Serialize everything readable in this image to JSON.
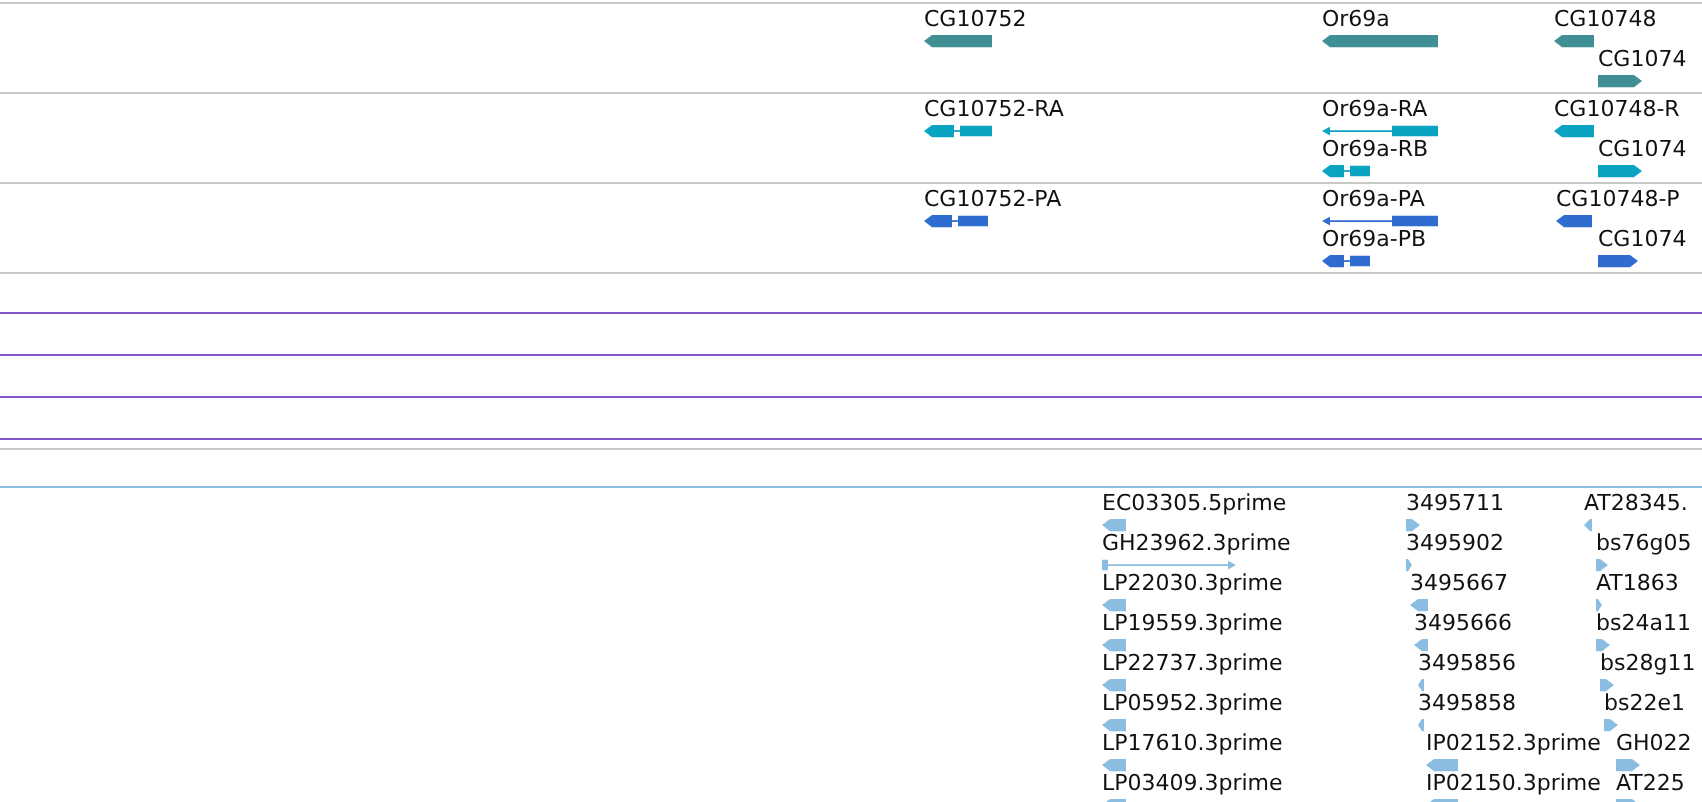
{
  "tracks": [
    {
      "kind": "features",
      "color": "#3f8f94",
      "features": [
        {
          "label": "CG10752",
          "reverse": true,
          "kind": "block"
        },
        {
          "label": "Or69a",
          "reverse": true,
          "kind": "block"
        },
        {
          "label": "CG10748",
          "reverse": true,
          "kind": "block"
        },
        {
          "label": "CG1074",
          "reverse": false,
          "kind": "block"
        }
      ]
    },
    {
      "kind": "features",
      "color": "#0aa3c2",
      "features": [
        {
          "label": "CG10752-RA",
          "reverse": true,
          "kind": "exons"
        },
        {
          "label": "Or69a-RA",
          "reverse": true,
          "kind": "spliced"
        },
        {
          "label": "Or69a-RB",
          "reverse": true,
          "kind": "exons"
        },
        {
          "label": "CG10748-R",
          "reverse": true,
          "kind": "block"
        },
        {
          "label": "CG1074",
          "reverse": false,
          "kind": "block"
        }
      ]
    },
    {
      "kind": "features",
      "color": "#2f6cd0",
      "features": [
        {
          "label": "CG10752-PA",
          "reverse": true,
          "kind": "exons"
        },
        {
          "label": "Or69a-PA",
          "reverse": true,
          "kind": "spliced"
        },
        {
          "label": "Or69a-PB",
          "reverse": true,
          "kind": "exons"
        },
        {
          "label": "CG10748-P",
          "reverse": true,
          "kind": "block"
        },
        {
          "label": "CG1074",
          "reverse": false,
          "kind": "block"
        }
      ]
    },
    {
      "kind": "empty",
      "color": "#7e57c2"
    },
    {
      "kind": "empty",
      "color": "#7e57c2"
    },
    {
      "kind": "empty",
      "color": "#7e57c2"
    },
    {
      "kind": "empty",
      "color": "#7e57c2"
    },
    {
      "kind": "features",
      "color": "#8bbde0",
      "features": [
        {
          "label": "EC03305.5prime",
          "reverse": true,
          "kind": "block"
        },
        {
          "label": "GH23962.3prime",
          "reverse": false,
          "kind": "spliced"
        },
        {
          "label": "LP22030.3prime",
          "reverse": true,
          "kind": "block"
        },
        {
          "label": "LP19559.3prime",
          "reverse": true,
          "kind": "block"
        },
        {
          "label": "LP22737.3prime",
          "reverse": true,
          "kind": "block"
        },
        {
          "label": "LP05952.3prime",
          "reverse": true,
          "kind": "block"
        },
        {
          "label": "LP17610.3prime",
          "reverse": true,
          "kind": "block"
        },
        {
          "label": "LP03409.3prime",
          "reverse": true,
          "kind": "block"
        },
        {
          "label": "3495711",
          "reverse": false,
          "kind": "block"
        },
        {
          "label": "3495902",
          "reverse": false,
          "kind": "block"
        },
        {
          "label": "3495667",
          "reverse": true,
          "kind": "block"
        },
        {
          "label": "3495666",
          "reverse": true,
          "kind": "block"
        },
        {
          "label": "3495856",
          "reverse": true,
          "kind": "block"
        },
        {
          "label": "3495858",
          "reverse": true,
          "kind": "block"
        },
        {
          "label": "IP02152.3prime",
          "reverse": true,
          "kind": "block"
        },
        {
          "label": "IP02150.3prime",
          "reverse": true,
          "kind": "block"
        },
        {
          "label": "AT28345.",
          "reverse": true,
          "kind": "block"
        },
        {
          "label": "bs76g05",
          "reverse": false,
          "kind": "block"
        },
        {
          "label": "AT1863",
          "reverse": false,
          "kind": "block"
        },
        {
          "label": "bs24a11",
          "reverse": false,
          "kind": "block"
        },
        {
          "label": "bs28g11",
          "reverse": false,
          "kind": "block"
        },
        {
          "label": "bs22e1",
          "reverse": false,
          "kind": "block"
        },
        {
          "label": "GH022",
          "reverse": false,
          "kind": "block"
        },
        {
          "label": "AT225",
          "reverse": false,
          "kind": "block"
        }
      ]
    }
  ]
}
